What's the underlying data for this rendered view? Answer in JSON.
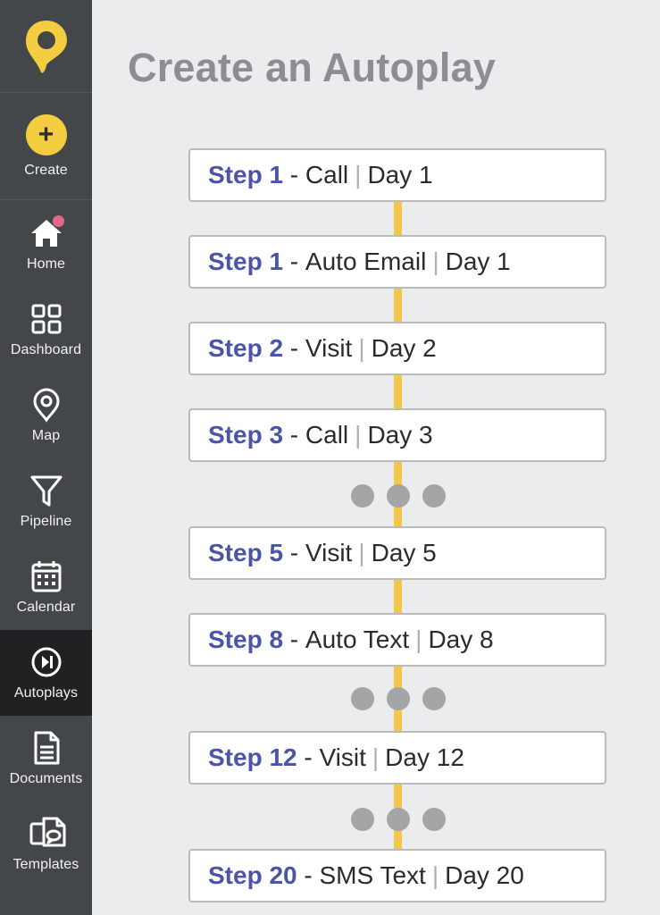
{
  "sidebar": {
    "create_label": "Create",
    "items": [
      {
        "label": "Home",
        "icon": "home-icon"
      },
      {
        "label": "Dashboard",
        "icon": "grid-icon"
      },
      {
        "label": "Map",
        "icon": "map-pin-icon"
      },
      {
        "label": "Pipeline",
        "icon": "funnel-icon"
      },
      {
        "label": "Calendar",
        "icon": "calendar-icon"
      },
      {
        "label": "Autoplays",
        "icon": "play-next-icon",
        "active": true
      },
      {
        "label": "Documents",
        "icon": "document-icon"
      },
      {
        "label": "Templates",
        "icon": "templates-icon"
      }
    ]
  },
  "colors": {
    "brand_yellow": "#f3cc3f",
    "sidebar_bg": "#444749",
    "sidebar_active_bg": "#1f2123",
    "step_blue": "#4a55a8",
    "connector": "#f3c84a",
    "notification_dot": "#e8658a"
  },
  "main": {
    "title": "Create an Autoplay",
    "steps": [
      {
        "name": "Step 1",
        "action": "Call",
        "day": "Day 1"
      },
      {
        "name": "Step 1",
        "action": "Auto Email",
        "day": "Day 1"
      },
      {
        "name": "Step 2",
        "action": "Visit",
        "day": "Day 2"
      },
      {
        "name": "Step 3",
        "action": "Call",
        "day": "Day 3"
      },
      {
        "name": "Step 5",
        "action": "Visit",
        "day": "Day 5"
      },
      {
        "name": "Step 8",
        "action": "Auto Text",
        "day": "Day 8"
      },
      {
        "name": "Step 12",
        "action": "Visit",
        "day": "Day 12"
      },
      {
        "name": "Step 20",
        "action": "SMS Text",
        "day": "Day 20"
      }
    ]
  }
}
